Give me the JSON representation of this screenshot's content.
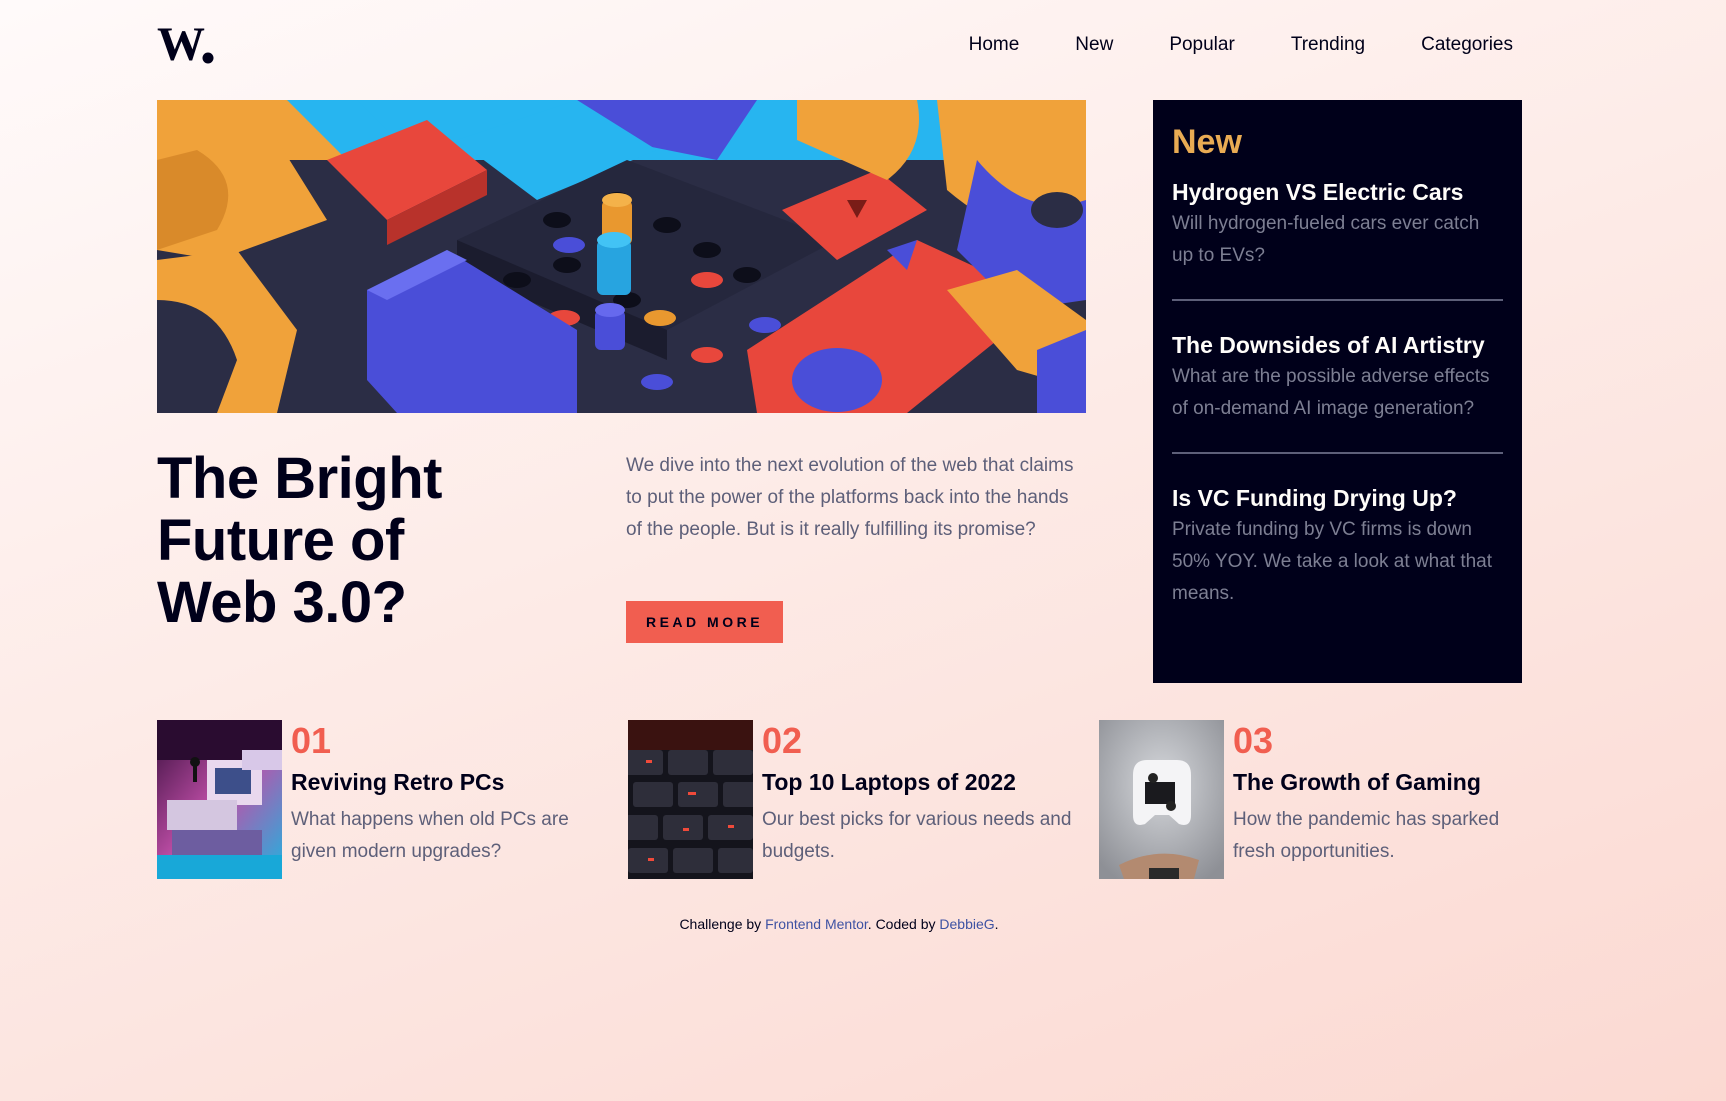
{
  "header": {
    "logo_alt": "W.",
    "nav": [
      "Home",
      "New",
      "Popular",
      "Trending",
      "Categories"
    ]
  },
  "hero": {
    "title_lines": [
      "The Bright",
      "Future of",
      "Web 3.0?"
    ],
    "description": "We dive into the next evolution of the web that claims to put the power of the platforms back into the hands of the people. But is it really fulfilling its promise?",
    "button_label": "READ MORE"
  },
  "sidebar": {
    "title": "New",
    "items": [
      {
        "title": "Hydrogen VS Electric Cars",
        "desc": "Will hydrogen-fueled cars ever catch up to EVs?"
      },
      {
        "title": "The Downsides of AI Artistry",
        "desc": "What are the possible adverse effects of on-demand AI image generation?"
      },
      {
        "title": "Is VC Funding Drying Up?",
        "desc": "Private funding by VC firms is down 50% YOY. We take a look at what that means."
      }
    ]
  },
  "articles": [
    {
      "num": "01",
      "title": "Reviving Retro PCs",
      "desc": "What happens when old PCs are given modern upgrades?"
    },
    {
      "num": "02",
      "title": "Top 10 Laptops of 2022",
      "desc": "Our best picks for various needs and budgets."
    },
    {
      "num": "03",
      "title": "The Growth of Gaming",
      "desc": "How the pandemic has sparked fresh opportunities."
    }
  ],
  "footer": {
    "prefix": "Challenge by ",
    "link1": "Frontend Mentor",
    "middle": ". Coded by ",
    "link2": "DebbieG",
    "suffix": "."
  },
  "colors": {
    "accent_red": "#f15e50",
    "accent_orange": "#e9ab53",
    "dark": "#00001a",
    "grayish_blue": "#5d5f79"
  }
}
